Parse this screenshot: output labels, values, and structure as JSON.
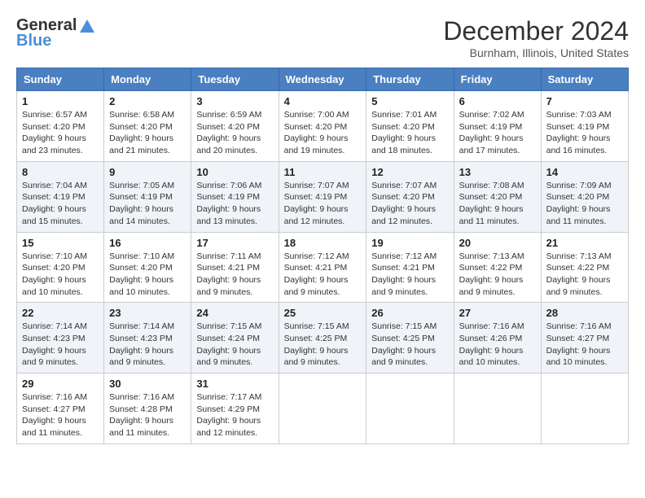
{
  "logo": {
    "line1": "General",
    "line2": "Blue"
  },
  "title": "December 2024",
  "location": "Burnham, Illinois, United States",
  "days_of_week": [
    "Sunday",
    "Monday",
    "Tuesday",
    "Wednesday",
    "Thursday",
    "Friday",
    "Saturday"
  ],
  "weeks": [
    [
      {
        "day": 1,
        "sunrise": "6:57 AM",
        "sunset": "4:20 PM",
        "daylight": "9 hours and 23 minutes."
      },
      {
        "day": 2,
        "sunrise": "6:58 AM",
        "sunset": "4:20 PM",
        "daylight": "9 hours and 21 minutes."
      },
      {
        "day": 3,
        "sunrise": "6:59 AM",
        "sunset": "4:20 PM",
        "daylight": "9 hours and 20 minutes."
      },
      {
        "day": 4,
        "sunrise": "7:00 AM",
        "sunset": "4:20 PM",
        "daylight": "9 hours and 19 minutes."
      },
      {
        "day": 5,
        "sunrise": "7:01 AM",
        "sunset": "4:20 PM",
        "daylight": "9 hours and 18 minutes."
      },
      {
        "day": 6,
        "sunrise": "7:02 AM",
        "sunset": "4:19 PM",
        "daylight": "9 hours and 17 minutes."
      },
      {
        "day": 7,
        "sunrise": "7:03 AM",
        "sunset": "4:19 PM",
        "daylight": "9 hours and 16 minutes."
      }
    ],
    [
      {
        "day": 8,
        "sunrise": "7:04 AM",
        "sunset": "4:19 PM",
        "daylight": "9 hours and 15 minutes."
      },
      {
        "day": 9,
        "sunrise": "7:05 AM",
        "sunset": "4:19 PM",
        "daylight": "9 hours and 14 minutes."
      },
      {
        "day": 10,
        "sunrise": "7:06 AM",
        "sunset": "4:19 PM",
        "daylight": "9 hours and 13 minutes."
      },
      {
        "day": 11,
        "sunrise": "7:07 AM",
        "sunset": "4:19 PM",
        "daylight": "9 hours and 12 minutes."
      },
      {
        "day": 12,
        "sunrise": "7:07 AM",
        "sunset": "4:20 PM",
        "daylight": "9 hours and 12 minutes."
      },
      {
        "day": 13,
        "sunrise": "7:08 AM",
        "sunset": "4:20 PM",
        "daylight": "9 hours and 11 minutes."
      },
      {
        "day": 14,
        "sunrise": "7:09 AM",
        "sunset": "4:20 PM",
        "daylight": "9 hours and 11 minutes."
      }
    ],
    [
      {
        "day": 15,
        "sunrise": "7:10 AM",
        "sunset": "4:20 PM",
        "daylight": "9 hours and 10 minutes."
      },
      {
        "day": 16,
        "sunrise": "7:10 AM",
        "sunset": "4:20 PM",
        "daylight": "9 hours and 10 minutes."
      },
      {
        "day": 17,
        "sunrise": "7:11 AM",
        "sunset": "4:21 PM",
        "daylight": "9 hours and 9 minutes."
      },
      {
        "day": 18,
        "sunrise": "7:12 AM",
        "sunset": "4:21 PM",
        "daylight": "9 hours and 9 minutes."
      },
      {
        "day": 19,
        "sunrise": "7:12 AM",
        "sunset": "4:21 PM",
        "daylight": "9 hours and 9 minutes."
      },
      {
        "day": 20,
        "sunrise": "7:13 AM",
        "sunset": "4:22 PM",
        "daylight": "9 hours and 9 minutes."
      },
      {
        "day": 21,
        "sunrise": "7:13 AM",
        "sunset": "4:22 PM",
        "daylight": "9 hours and 9 minutes."
      }
    ],
    [
      {
        "day": 22,
        "sunrise": "7:14 AM",
        "sunset": "4:23 PM",
        "daylight": "9 hours and 9 minutes."
      },
      {
        "day": 23,
        "sunrise": "7:14 AM",
        "sunset": "4:23 PM",
        "daylight": "9 hours and 9 minutes."
      },
      {
        "day": 24,
        "sunrise": "7:15 AM",
        "sunset": "4:24 PM",
        "daylight": "9 hours and 9 minutes."
      },
      {
        "day": 25,
        "sunrise": "7:15 AM",
        "sunset": "4:25 PM",
        "daylight": "9 hours and 9 minutes."
      },
      {
        "day": 26,
        "sunrise": "7:15 AM",
        "sunset": "4:25 PM",
        "daylight": "9 hours and 9 minutes."
      },
      {
        "day": 27,
        "sunrise": "7:16 AM",
        "sunset": "4:26 PM",
        "daylight": "9 hours and 10 minutes."
      },
      {
        "day": 28,
        "sunrise": "7:16 AM",
        "sunset": "4:27 PM",
        "daylight": "9 hours and 10 minutes."
      }
    ],
    [
      {
        "day": 29,
        "sunrise": "7:16 AM",
        "sunset": "4:27 PM",
        "daylight": "9 hours and 11 minutes."
      },
      {
        "day": 30,
        "sunrise": "7:16 AM",
        "sunset": "4:28 PM",
        "daylight": "9 hours and 11 minutes."
      },
      {
        "day": 31,
        "sunrise": "7:17 AM",
        "sunset": "4:29 PM",
        "daylight": "9 hours and 12 minutes."
      },
      null,
      null,
      null,
      null
    ]
  ],
  "labels": {
    "sunrise": "Sunrise:",
    "sunset": "Sunset:",
    "daylight": "Daylight:"
  }
}
